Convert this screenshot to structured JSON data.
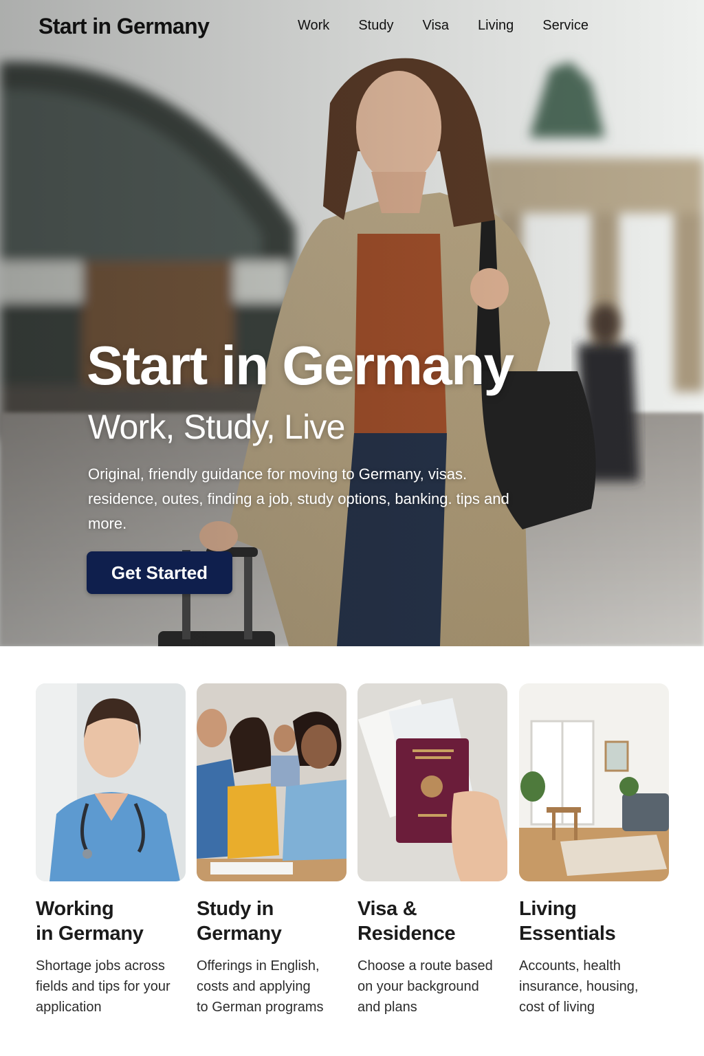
{
  "header": {
    "brand": "Start in Germany",
    "nav": [
      "Work",
      "Study",
      "Visa",
      "Living",
      "Service"
    ]
  },
  "hero": {
    "title": "Start in Germany",
    "subtitle": "Work, Study, Live",
    "description": "Original, friendly guidance for moving to Germany, visas. residence, outes, finding a job, study options, banking. tips and more.",
    "cta_label": "Get Started"
  },
  "cards": [
    {
      "title": "Working\nin Germany",
      "description": "Shortage jobs across\nfields and tips for your\napplication",
      "image": "nurse-photo"
    },
    {
      "title": "Study in\nGermany",
      "description": "Offerings in English,\ncosts and applying\nto German programs",
      "image": "students-photo"
    },
    {
      "title": "Visa &\nResidence",
      "description": "Choose a route based\non your background\nand plans",
      "image": "passport-photo"
    },
    {
      "title": "Living\nEssentials",
      "description": "Accounts, health\ninsurance, housing,\ncost of living",
      "image": "apartment-photo"
    }
  ],
  "colors": {
    "cta_background": "#0f1f4d",
    "text_dark": "#1b1b1b"
  }
}
